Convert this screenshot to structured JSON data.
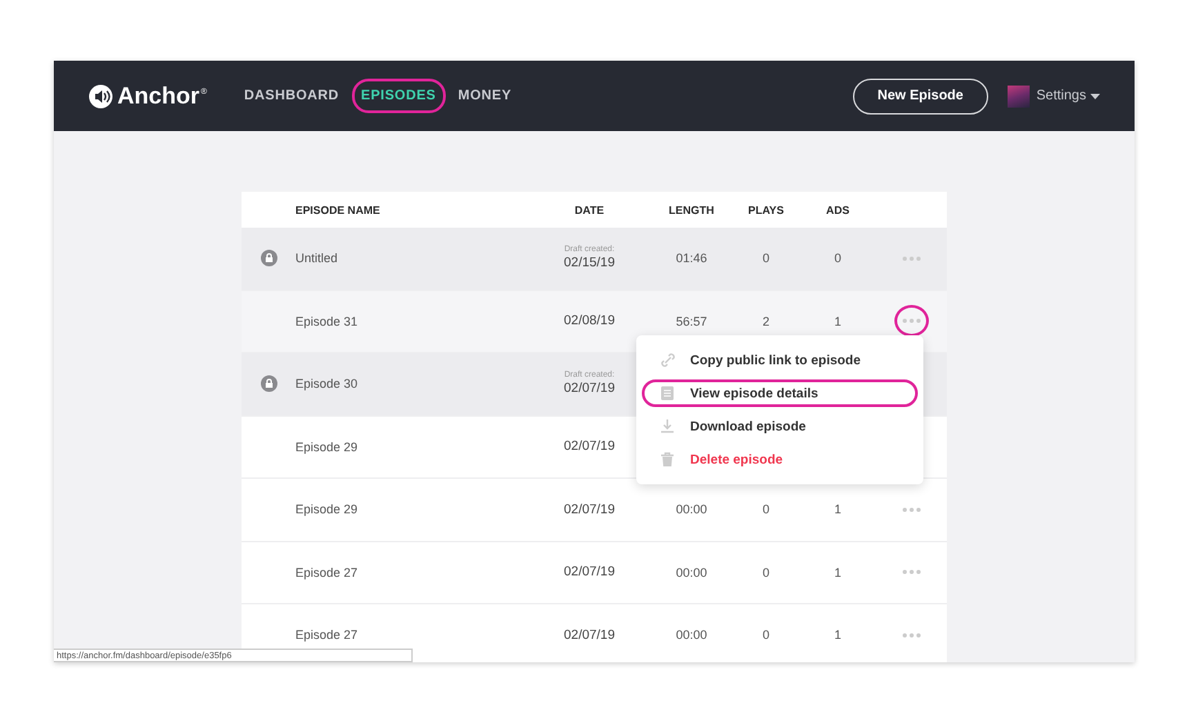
{
  "navbar": {
    "logo": "Anchor",
    "logo_mark": "®",
    "nav": [
      {
        "label": "DASHBOARD",
        "selected": false,
        "highlighted": false
      },
      {
        "label": "EPISODES",
        "selected": true,
        "highlighted": true
      },
      {
        "label": "MONEY",
        "selected": false,
        "highlighted": false
      }
    ],
    "new_button": "New Episode",
    "settings": "Settings"
  },
  "table": {
    "columns": [
      "EPISODE NAME",
      "DATE",
      "LENGTH",
      "PLAYS",
      "ADS"
    ],
    "rows": [
      {
        "name": "Untitled",
        "draft": true,
        "date_note": "Draft created:",
        "date": "02/15/19",
        "length": "01:46",
        "plays": "0",
        "ads": "0",
        "hovered": false,
        "menu_highlighted": false
      },
      {
        "name": "Episode 31",
        "draft": false,
        "date": "02/08/19",
        "length": "56:57",
        "plays": "2",
        "ads": "1",
        "hovered": true,
        "menu_highlighted": true
      },
      {
        "name": "Episode 30",
        "draft": true,
        "date_note": "Draft created:",
        "date": "02/07/19",
        "length": "",
        "plays": "",
        "ads": "",
        "hovered": false,
        "menu_highlighted": false
      },
      {
        "name": "Episode 29",
        "draft": false,
        "date": "02/07/19",
        "length": "",
        "plays": "",
        "ads": "",
        "hovered": false,
        "menu_highlighted": false
      },
      {
        "name": "Episode 29",
        "draft": false,
        "date": "02/07/19",
        "length": "00:00",
        "plays": "0",
        "ads": "1",
        "hovered": false,
        "menu_highlighted": false
      },
      {
        "name": "Episode 27",
        "draft": false,
        "date": "02/07/19",
        "length": "00:00",
        "plays": "0",
        "ads": "1",
        "hovered": false,
        "menu_highlighted": false
      },
      {
        "name": "Episode 27",
        "draft": false,
        "date": "02/07/19",
        "length": "00:00",
        "plays": "0",
        "ads": "1",
        "hovered": false,
        "menu_highlighted": false
      }
    ]
  },
  "context_menu": {
    "items": [
      {
        "kind": "link",
        "label": "Copy public link to episode",
        "highlighted": false
      },
      {
        "kind": "details",
        "label": "View episode details",
        "highlighted": true
      },
      {
        "kind": "download",
        "label": "Download episode",
        "highlighted": false
      },
      {
        "kind": "delete",
        "label": "Delete episode",
        "highlighted": false
      }
    ]
  },
  "status_url": "https://anchor.fm/dashboard/episode/e35fp6"
}
